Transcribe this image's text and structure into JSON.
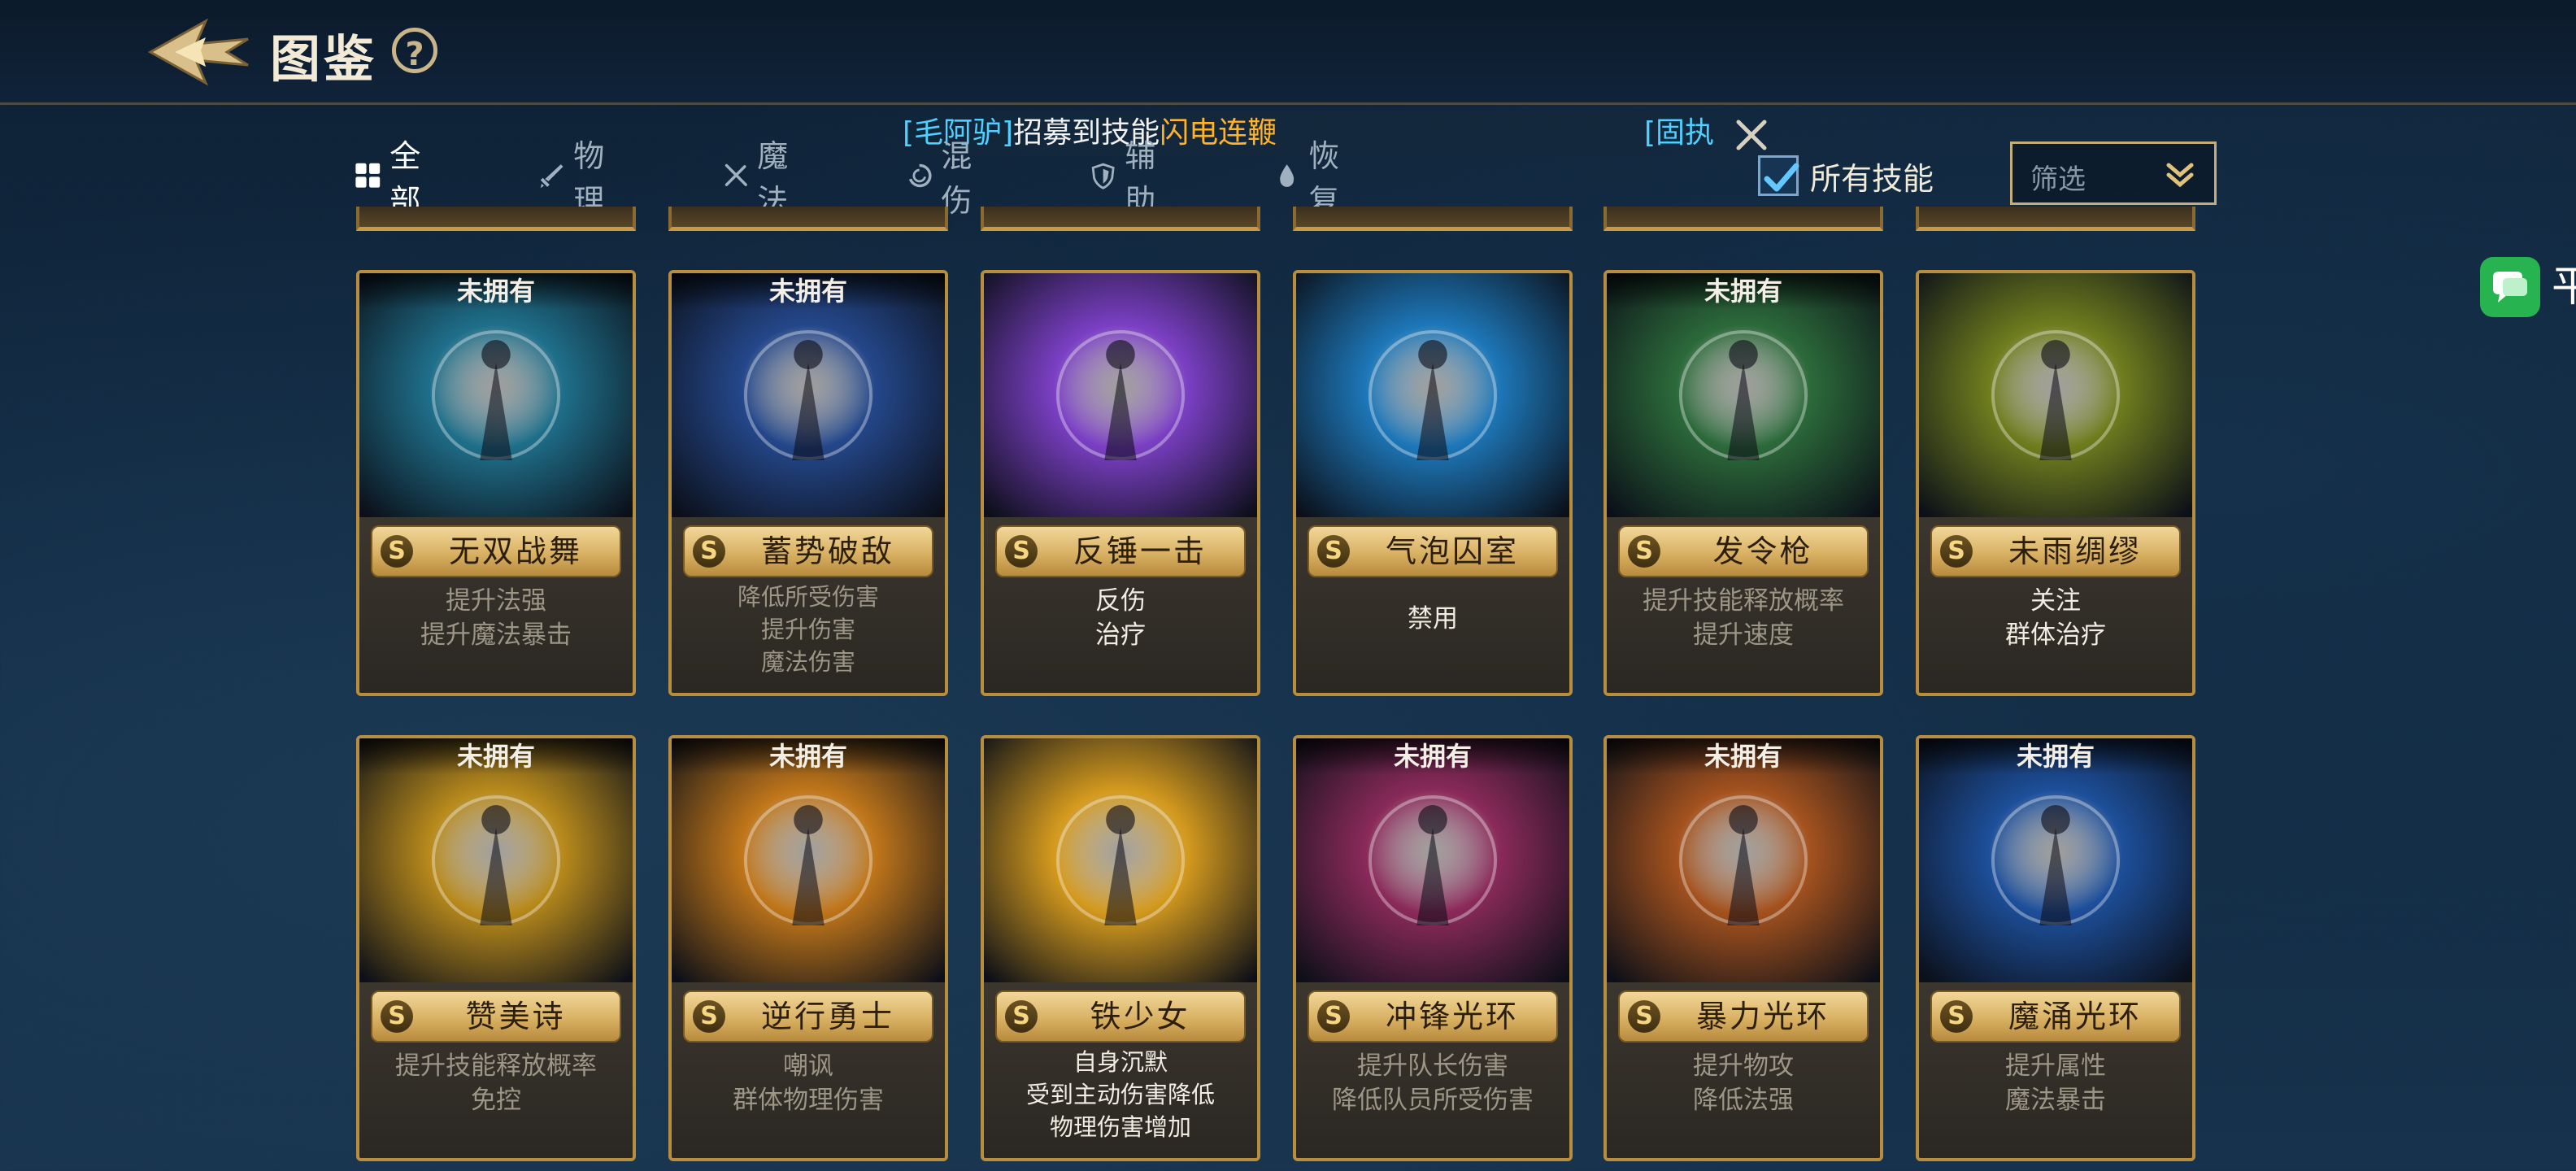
{
  "header": {
    "title": "图鉴",
    "help_glyph": "?"
  },
  "broadcast": {
    "player": "[毛阿驴]",
    "middle": "招募到技能",
    "skill": "闪电连鞭",
    "next_fragment": "[固执"
  },
  "tabs": [
    {
      "label": "全部",
      "icon": "grid-icon",
      "active": true
    },
    {
      "label": "物理",
      "icon": "sword-icon",
      "active": false
    },
    {
      "label": "魔法",
      "icon": "crossed-staves-icon",
      "active": false
    },
    {
      "label": "混伤",
      "icon": "swirl-icon",
      "active": false
    },
    {
      "label": "辅助",
      "icon": "shield-icon",
      "active": false
    },
    {
      "label": "恢复",
      "icon": "drop-icon",
      "active": false
    }
  ],
  "all_skills": {
    "label": "所有技能",
    "checked": true
  },
  "filter": {
    "label": "筛选"
  },
  "side_chip": {
    "text": "平"
  },
  "cards": [
    {
      "owned_label": "未拥有",
      "grade": "S",
      "name": "无双战舞",
      "desc": [
        "提升法强",
        "提升魔法暴击"
      ],
      "theme": "#1f6f8a"
    },
    {
      "owned_label": "未拥有",
      "grade": "S",
      "name": "蓄势破敌",
      "desc": [
        "降低所受伤害",
        "提升伤害",
        "魔法伤害"
      ],
      "theme": "#24478a"
    },
    {
      "owned_label": "",
      "grade": "S",
      "name": "反锤一击",
      "desc": [
        "反伤",
        "治疗"
      ],
      "theme": "#7b3fc4"
    },
    {
      "owned_label": "",
      "grade": "S",
      "name": "气泡囚室",
      "desc": [
        "禁用"
      ],
      "theme": "#1d77b8"
    },
    {
      "owned_label": "未拥有",
      "grade": "S",
      "name": "发令枪",
      "desc": [
        "提升技能释放概率",
        "提升速度"
      ],
      "theme": "#2c6a3a"
    },
    {
      "owned_label": "",
      "grade": "S",
      "name": "未雨绸缪",
      "desc": [
        "关注",
        "群体治疗"
      ],
      "theme": "#6f7d1e"
    },
    {
      "owned_label": "未拥有",
      "grade": "S",
      "name": "赞美诗",
      "desc": [
        "提升技能释放概率",
        "免控"
      ],
      "theme": "#b88a1c"
    },
    {
      "owned_label": "未拥有",
      "grade": "S",
      "name": "逆行勇士",
      "desc": [
        "嘲讽",
        "群体物理伤害"
      ],
      "theme": "#c0761a"
    },
    {
      "owned_label": "",
      "grade": "S",
      "name": "铁少女",
      "desc": [
        "自身沉默",
        "受到主动伤害降低",
        "物理伤害增加"
      ],
      "theme": "#d49a1e"
    },
    {
      "owned_label": "未拥有",
      "grade": "S",
      "name": "冲锋光环",
      "desc": [
        "提升队长伤害",
        "降低队员所受伤害"
      ],
      "theme": "#8a2a5a"
    },
    {
      "owned_label": "未拥有",
      "grade": "S",
      "name": "暴力光环",
      "desc": [
        "提升物攻",
        "降低法强"
      ],
      "theme": "#a4521e"
    },
    {
      "owned_label": "未拥有",
      "grade": "S",
      "name": "魔涌光环",
      "desc": [
        "提升属性",
        "魔法暴击"
      ],
      "theme": "#1d4f9a"
    }
  ]
}
